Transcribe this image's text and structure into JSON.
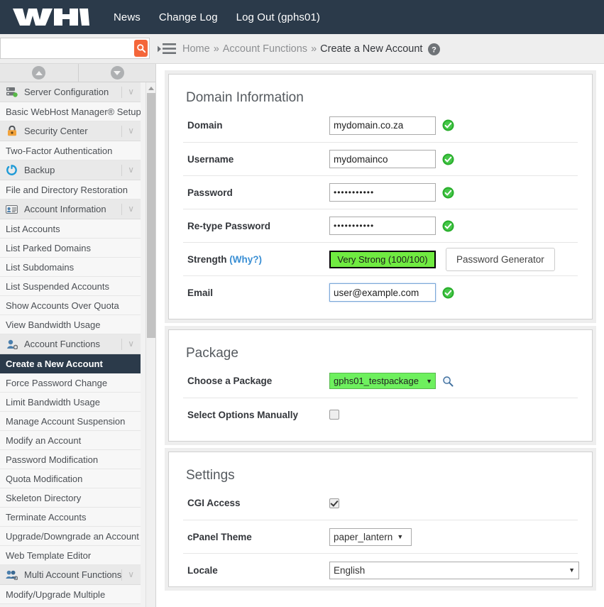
{
  "topbar": {
    "logo_text": "WHM",
    "links": [
      {
        "label": "News"
      },
      {
        "label": "Change Log"
      },
      {
        "label": "Log Out (gphs01)"
      }
    ]
  },
  "search": {
    "value": "",
    "placeholder": "",
    "icon": "search-icon"
  },
  "breadcrumb": {
    "items": [
      {
        "label": "Home",
        "current": false
      },
      {
        "label": "Account Functions",
        "current": false
      },
      {
        "label": "Create a New Account",
        "current": true
      }
    ],
    "separator": "»",
    "help_icon": "help-circle-icon"
  },
  "sidebar": {
    "scroll_up_icon": "chevron-up-circle-icon",
    "scroll_down_icon": "chevron-down-circle-icon",
    "entries": [
      {
        "type": "group",
        "label": "Server Configuration",
        "icon": "server-icon",
        "caret": "∨"
      },
      {
        "type": "item",
        "label": "Basic WebHost Manager® Setup",
        "active": false
      },
      {
        "type": "group",
        "label": "Security Center",
        "icon": "lock-icon",
        "caret": "∨"
      },
      {
        "type": "item",
        "label": "Two-Factor Authentication",
        "active": false
      },
      {
        "type": "group",
        "label": "Backup",
        "icon": "backup-icon",
        "caret": "∨"
      },
      {
        "type": "item",
        "label": "File and Directory Restoration",
        "active": false
      },
      {
        "type": "group",
        "label": "Account Information",
        "icon": "account-info-icon",
        "caret": "∨"
      },
      {
        "type": "item",
        "label": "List Accounts",
        "active": false
      },
      {
        "type": "item",
        "label": "List Parked Domains",
        "active": false
      },
      {
        "type": "item",
        "label": "List Subdomains",
        "active": false
      },
      {
        "type": "item",
        "label": "List Suspended Accounts",
        "active": false
      },
      {
        "type": "item",
        "label": "Show Accounts Over Quota",
        "active": false
      },
      {
        "type": "item",
        "label": "View Bandwidth Usage",
        "active": false
      },
      {
        "type": "group",
        "label": "Account Functions",
        "icon": "user-gear-icon",
        "caret": "∨"
      },
      {
        "type": "item",
        "label": "Create a New Account",
        "active": true
      },
      {
        "type": "item",
        "label": "Force Password Change",
        "active": false
      },
      {
        "type": "item",
        "label": "Limit Bandwidth Usage",
        "active": false
      },
      {
        "type": "item",
        "label": "Manage Account Suspension",
        "active": false
      },
      {
        "type": "item",
        "label": "Modify an Account",
        "active": false
      },
      {
        "type": "item",
        "label": "Password Modification",
        "active": false
      },
      {
        "type": "item",
        "label": "Quota Modification",
        "active": false
      },
      {
        "type": "item",
        "label": "Skeleton Directory",
        "active": false
      },
      {
        "type": "item",
        "label": "Terminate Accounts",
        "active": false
      },
      {
        "type": "item",
        "label": "Upgrade/Downgrade an Account",
        "active": false
      },
      {
        "type": "item",
        "label": "Web Template Editor",
        "active": false
      },
      {
        "type": "group",
        "label": "Multi Account Functions",
        "icon": "users-gear-icon",
        "caret": "∨"
      },
      {
        "type": "item",
        "label": "Modify/Upgrade Multiple",
        "active": false
      }
    ]
  },
  "domain_information": {
    "title": "Domain Information",
    "domain": {
      "label": "Domain",
      "value": "mydomain.co.za",
      "valid_icon": "check-circle-icon"
    },
    "username": {
      "label": "Username",
      "value": "mydomainco",
      "valid_icon": "check-circle-icon"
    },
    "password": {
      "label": "Password",
      "value": "•••••••••••",
      "valid_icon": "check-circle-icon"
    },
    "retype_password": {
      "label": "Re-type Password",
      "value": "•••••••••••",
      "valid_icon": "check-circle-icon"
    },
    "strength": {
      "label": "Strength",
      "why_label": "(Why?)",
      "value": "Very Strong (100/100)",
      "score": 100,
      "max_score": 100,
      "bar_color": "#70eb41",
      "generator_button": "Password Generator"
    },
    "email": {
      "label": "Email",
      "value": "user@example.com",
      "valid_icon": "check-circle-icon",
      "focused": true
    }
  },
  "package": {
    "title": "Package",
    "choose": {
      "label": "Choose a Package",
      "value": "gphs01_testpackage",
      "highlight_color": "#6ef05e",
      "search_icon": "magnifier-icon"
    },
    "manual": {
      "label": "Select Options Manually",
      "checked": false
    }
  },
  "settings": {
    "title": "Settings",
    "cgi_access": {
      "label": "CGI Access",
      "checked": true
    },
    "cpanel_theme": {
      "label": "cPanel Theme",
      "value": "paper_lantern"
    },
    "locale": {
      "label": "Locale",
      "value": "English"
    }
  }
}
